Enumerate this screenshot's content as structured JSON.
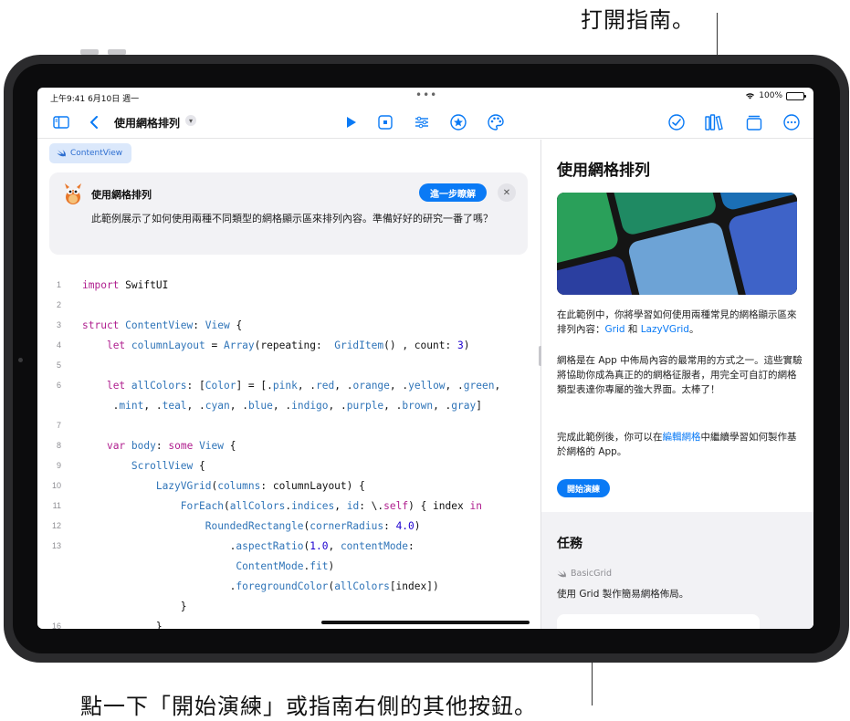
{
  "callouts": {
    "top": "打開指南。",
    "bottom": "點一下「開始演練」或指南右側的其他按鈕。"
  },
  "status_bar": {
    "time": "上午9:41  6月10日 週一",
    "dots": "•••",
    "battery": "100%"
  },
  "toolbar": {
    "title": "使用網格排列",
    "icons": [
      "sidebar-icon",
      "back-icon",
      "run-icon",
      "stop-icon",
      "settings-sliders-icon",
      "star-icon",
      "palette-icon",
      "checkmark-icon",
      "guide-books-icon",
      "windows-icon",
      "more-icon"
    ]
  },
  "editor": {
    "file_tag": "ContentView",
    "banner": {
      "title": "使用網格排列",
      "learn_more": "進一步瞭解",
      "close": "✕",
      "body": "此範例展示了如何使用兩種不同類型的網格顯示區來排列內容。準備好好的研究一番了嗎？"
    },
    "line_numbers": [
      "1",
      "2",
      "3",
      "4",
      "5",
      "6",
      "",
      "7",
      "8",
      "9",
      "10",
      "11",
      "12",
      "13",
      "",
      "",
      "",
      "16"
    ],
    "code_lines": [
      "import SwiftUI",
      "",
      "struct ContentView: View {",
      "    let columnLayout = Array(repeating:  GridItem() , count: 3)",
      "",
      "    let allColors: [Color] = [.pink, .red, .orange, .yellow, .green,",
      "     .mint, .teal, .cyan, .blue, .indigo, .purple, .brown, .gray]",
      "",
      "    var body: some View {",
      "        ScrollView {",
      "            LazyVGrid(columns: columnLayout) {",
      "                ForEach(allColors.indices, id: \\.self) { index in",
      "                    RoundedRectangle(cornerRadius: 4.0)",
      "                        .aspectRatio(1.0, contentMode:",
      "                         ContentMode.fit)",
      "                        .foregroundColor(allColors[index])",
      "                }",
      "            }"
    ]
  },
  "guide": {
    "title": "使用網格排列",
    "para1_a": "在此範例中，你將學習如何使用兩種常見的網格顯示區來排列內容：",
    "para1_link1": "Grid",
    "para1_b": " 和 ",
    "para1_link2": "LazyVGrid",
    "para1_c": "。",
    "para2": "網格是在 App 中佈局內容的最常用的方式之一。這些實驗將協助你成為真正的的網格征服者，用完全可自訂的網格類型表達你專屬的強大界面。太棒了！",
    "para3_a": "完成此範例後，你可以在",
    "para3_link": "編輯網格",
    "para3_b": "中繼續學習如何製作基於網格的 App。",
    "walkthrough_button": "開始演練",
    "tasks_heading": "任務",
    "task_file": "BasicGrid",
    "task_desc": "使用 Grid 製作簡易網格佈局。"
  },
  "colors": {
    "accent": "#0a7af5",
    "keyword": "#b0208f",
    "type": "#2f74b8",
    "number": "#1c00cf"
  }
}
